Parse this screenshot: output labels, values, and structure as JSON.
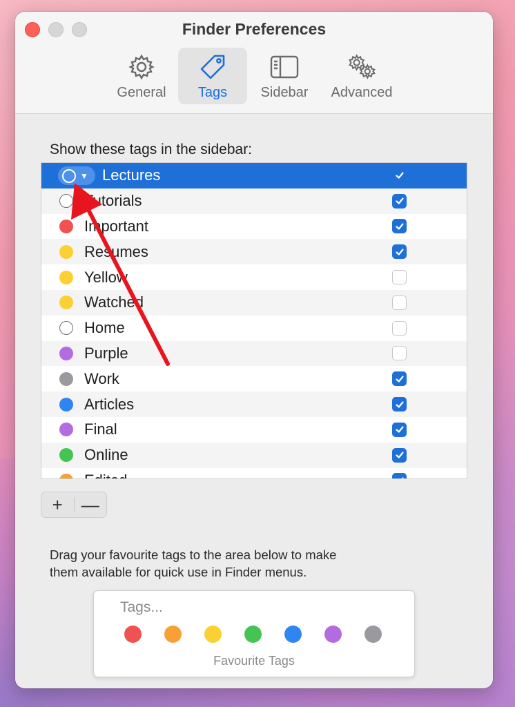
{
  "window": {
    "title": "Finder Preferences"
  },
  "toolbar": {
    "tabs": [
      {
        "label": "General",
        "icon": "gear-icon"
      },
      {
        "label": "Tags",
        "icon": "tag-icon",
        "active": true
      },
      {
        "label": "Sidebar",
        "icon": "sidebar-icon"
      },
      {
        "label": "Advanced",
        "icon": "gears-icon"
      }
    ]
  },
  "tags_section": {
    "label": "Show these tags in the sidebar:",
    "rows": [
      {
        "name": "Lectures",
        "color": "none",
        "checked": true,
        "selected": true
      },
      {
        "name": "Tutorials",
        "color": "none",
        "checked": true
      },
      {
        "name": "Important",
        "color": "#f05252",
        "checked": true
      },
      {
        "name": "Resumes",
        "color": "#fbd034",
        "checked": true
      },
      {
        "name": "Yellow",
        "color": "#fbd034",
        "checked": false
      },
      {
        "name": "Watched",
        "color": "#fbd034",
        "checked": false
      },
      {
        "name": "Home",
        "color": "none",
        "checked": false
      },
      {
        "name": "Purple",
        "color": "#b36ce0",
        "checked": false
      },
      {
        "name": "Work",
        "color": "#9a9a9e",
        "checked": true
      },
      {
        "name": "Articles",
        "color": "#2f86f2",
        "checked": true
      },
      {
        "name": "Final",
        "color": "#b36ce0",
        "checked": true
      },
      {
        "name": "Online",
        "color": "#45c454",
        "checked": true
      },
      {
        "name": "Edited",
        "color": "#f7a035",
        "checked": true
      }
    ]
  },
  "buttons": {
    "add": "+",
    "remove": "—"
  },
  "hint": {
    "line1": "Drag your favourite tags to the area below to make",
    "line2": "them available for quick use in Finder menus."
  },
  "favourites": {
    "label": "Tags...",
    "caption": "Favourite Tags",
    "colors": [
      "#f05252",
      "#f7a035",
      "#fbd034",
      "#45c454",
      "#2f86f2",
      "#b36ce0",
      "#9a9a9e"
    ]
  },
  "annotation": {
    "arrow_color": "#e8141e"
  }
}
